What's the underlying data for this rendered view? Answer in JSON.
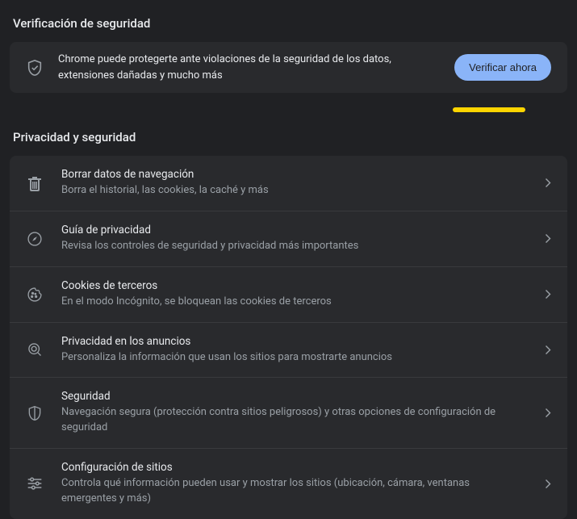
{
  "section_safety": {
    "title": "Verificación de seguridad"
  },
  "banner": {
    "text": "Chrome puede protegerte ante violaciones de la seguridad de los datos, extensiones dañadas y mucho más",
    "button": "Verificar ahora"
  },
  "section_privacy": {
    "title": "Privacidad y seguridad"
  },
  "rows": {
    "clear": {
      "title": "Borrar datos de navegación",
      "sub": "Borra el historial, las cookies, la caché y más"
    },
    "guide": {
      "title": "Guía de privacidad",
      "sub": "Revisa los controles de seguridad y privacidad más importantes"
    },
    "cookies": {
      "title": "Cookies de terceros",
      "sub": "En el modo Incógnito, se bloquean las cookies de terceros"
    },
    "ads": {
      "title": "Privacidad en los anuncios",
      "sub": "Personaliza la información que usan los sitios para mostrarte anuncios"
    },
    "security": {
      "title": "Seguridad",
      "sub": "Navegación segura (protección contra sitios peligrosos) y otras opciones de configuración de seguridad"
    },
    "site_settings": {
      "title": "Configuración de sitios",
      "sub": "Controla qué información pueden usar y mostrar los sitios (ubicación, cámara, ventanas emergentes y más)"
    }
  }
}
